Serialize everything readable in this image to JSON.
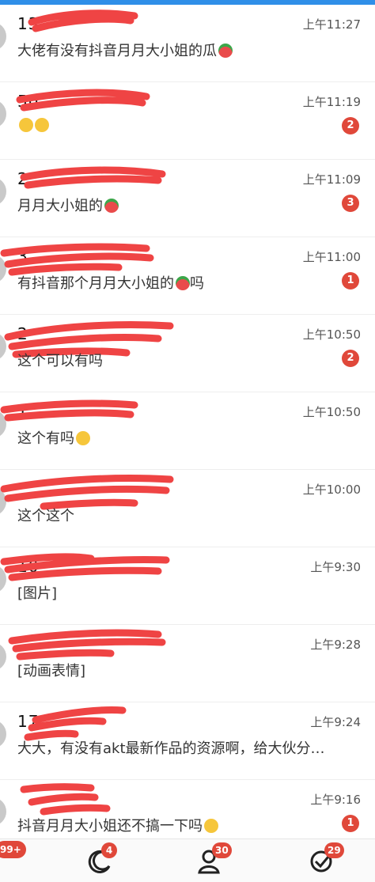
{
  "conversations": [
    {
      "name": "13",
      "message": "大佬有没有抖音月月大小姐的瓜",
      "emoji": "melon",
      "time": "上午11:27",
      "badge": ""
    },
    {
      "name": "50",
      "message": "",
      "emoji": "face2",
      "time": "上午11:19",
      "badge": "2"
    },
    {
      "name": "2",
      "message": "月月大小姐的",
      "emoji": "melon",
      "time": "上午11:09",
      "badge": "3"
    },
    {
      "name": "3",
      "message": "有抖音那个月月大小姐的",
      "emoji": "melon",
      "suffix": "吗",
      "time": "上午11:00",
      "badge": "1"
    },
    {
      "name": "2",
      "message": "这个可以有吗",
      "emoji": "",
      "time": "上午10:50",
      "badge": "2"
    },
    {
      "name": "1",
      "message": "这个有吗",
      "emoji": "face",
      "time": "上午10:50",
      "badge": ""
    },
    {
      "name": "",
      "message": "这个这个",
      "emoji": "",
      "time": "上午10:00",
      "badge": ""
    },
    {
      "name": "10",
      "message": "[图片]",
      "emoji": "",
      "time": "上午9:30",
      "badge": ""
    },
    {
      "name": "",
      "message": "[动画表情]",
      "emoji": "",
      "time": "上午9:28",
      "badge": ""
    },
    {
      "name": "17",
      "message": "大大，有没有akt最新作品的资源啊，给大伙分…",
      "emoji": "",
      "time": "上午9:24",
      "badge": ""
    },
    {
      "name": "",
      "message": "抖音月月大小姐还不搞一下吗",
      "emoji": "face",
      "time": "上午9:16",
      "badge": "1"
    }
  ],
  "bottom_nav": {
    "left_badge": "99+",
    "items": [
      {
        "icon": "moon-icon",
        "badge": "4"
      },
      {
        "icon": "person-icon",
        "badge": "30"
      },
      {
        "icon": "check-icon",
        "badge": "29"
      }
    ]
  },
  "colors": {
    "badge": "#e0483a",
    "scribble": "#ef4444"
  }
}
